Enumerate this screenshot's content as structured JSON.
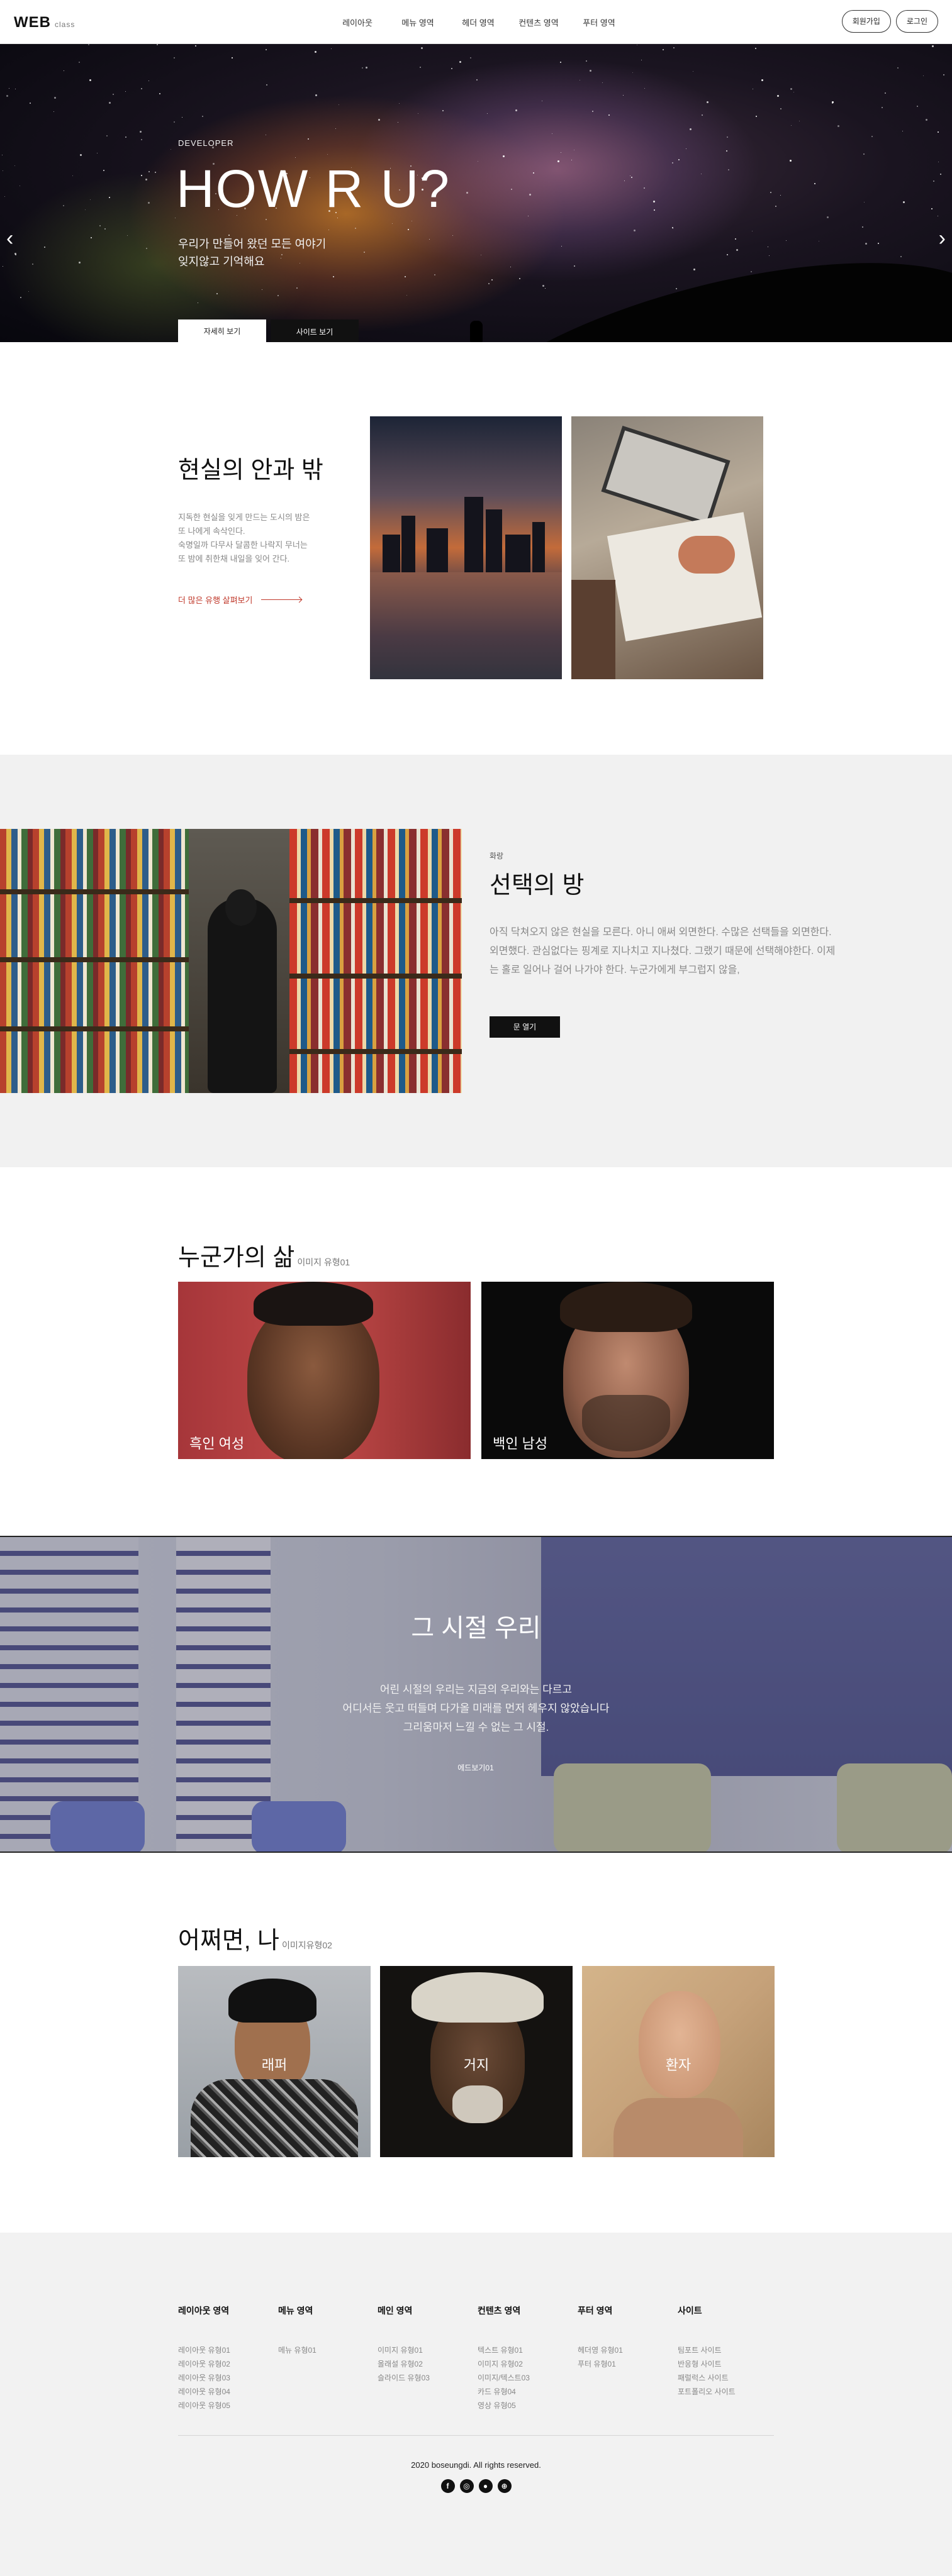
{
  "header": {
    "logo": "WEB",
    "logo_sub": "class",
    "nav": [
      "레이아웃",
      "메뉴 영역",
      "헤더 영역",
      "컨텐츠 영역",
      "푸터 영역"
    ],
    "signup": "회원가입",
    "login": "로그인"
  },
  "hero": {
    "eyebrow": "DEVELOPER",
    "title": "HOW R U?",
    "sub_line1": "우리가 만들어 왔던 모든 여야기",
    "sub_line2": "잊지않고 기억해요",
    "btn_detail": "자세히 보기",
    "btn_site": "사이트 보기",
    "prev_arrow": "chevron-left-icon",
    "next_arrow": "chevron-right-icon"
  },
  "section1": {
    "title": "현실의 안과 밖",
    "desc_line1": "지독한 현실을 잊게 만드는 도시의 밤은",
    "desc_line2": "또 나에게 속삭인다.",
    "desc_line3": "숙명일까 다무사 달콤한 나락지 무너는",
    "desc_line4": "또 밤에 취한채 내일을 잊어 간다.",
    "link": "더 많은 유행 살펴보기"
  },
  "section2": {
    "eyebrow": "화랑",
    "title": "선택의 방",
    "desc": "아직 닥쳐오지 않은 현실을 모른다. 아니 애써 외면한다. 수많은 선택들을 외면한다. 외면했다. 관심없다는 핑계로 지나치고 지나쳤다. 그랬기 때문에 선택해야한다. 이제는 홀로 일어나 걸어 나가야 한다. 누군가에게 부그럽지 않을,",
    "btn": "문 열기"
  },
  "section3": {
    "title": "누군가의 삶",
    "title_small": "이미지 유형01",
    "cards": [
      {
        "label": "흑인 여성"
      },
      {
        "label": "백인 남성"
      }
    ]
  },
  "section4": {
    "title": "그 시절 우리",
    "line1": "어린 시절의 우리는 지금의 우리와는 다르고",
    "line2": "어디서든 웃고 떠들며 다가올 미래를 먼저 헤우지 않았습니다",
    "line3": "그리움마저 느낄 수 없는 그 시절.",
    "btn": "에드보기01"
  },
  "section5": {
    "title": "어쩌면, 나",
    "title_small": "이미지유형02",
    "cards": [
      {
        "label": "래퍼"
      },
      {
        "label": "거지"
      },
      {
        "label": "환자"
      }
    ]
  },
  "footer": {
    "columns": [
      {
        "title": "레이아웃 영역",
        "items": [
          "레이아웃 유형01",
          "레이아웃 유형02",
          "레이아웃 유형03",
          "레이아웃 유형04",
          "레이아웃 유형05"
        ]
      },
      {
        "title": "메뉴 영역",
        "items": [
          "메뉴 유형01"
        ]
      },
      {
        "title": "메인 영역",
        "items": [
          "이미지 유형01",
          "올래설 유형02",
          "슬라이드 유형03"
        ]
      },
      {
        "title": "컨텐츠 영역",
        "items": [
          "텍스트 유형01",
          "이미지 유형02",
          "이미지/텍스트03",
          "카드 유형04",
          "영상 유형05"
        ]
      },
      {
        "title": "푸터 영역",
        "items": [
          "헤더영 유형01",
          "푸터 유형01"
        ]
      },
      {
        "title": "사이트",
        "items": [
          "팀포트 사이트",
          "반응형 사이트",
          "패럴럭스 사이트",
          "포트폴리오 사이트"
        ]
      }
    ],
    "copyright": "2020 boseungdi. All rights reserved.",
    "socials": [
      "facebook-icon",
      "instagram-icon",
      "github-icon",
      "dribbble-icon"
    ]
  }
}
